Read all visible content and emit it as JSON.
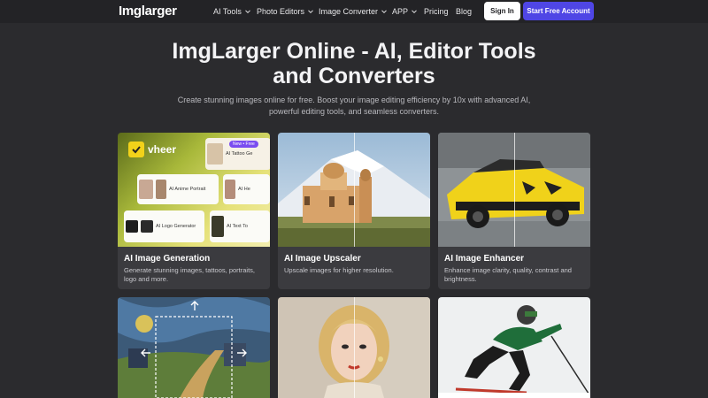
{
  "nav": {
    "logo": "Imglarger",
    "items": [
      "AI Tools",
      "Photo Editors",
      "Image Converter",
      "APP",
      "Pricing",
      "Blog"
    ],
    "signin": "Sign In",
    "start": "Start Free Account"
  },
  "hero": {
    "title_line1": "ImgLarger Online - AI, Editor Tools",
    "title_line2": "and Converters",
    "subtitle_line1": "Create stunning images online for free. Boost your image editing efficiency by 10x with advanced AI,",
    "subtitle_line2": "powerful editing tools, and seamless converters."
  },
  "cards": [
    {
      "title": "AI Image Generation",
      "desc": "Generate stunning images, tattoos, portraits, logo and more."
    },
    {
      "title": "AI Image Upscaler",
      "desc": "Upscale images for higher resolution."
    },
    {
      "title": "AI Image Enhancer",
      "desc": "Enhance image clarity, quality, contrast and brightness."
    }
  ],
  "vheer": {
    "brand": "vheer",
    "badge": "New • Free",
    "tiles": [
      "AI Tattoo Ge",
      "AI Anime Portrait",
      "AI He",
      "AI Logo Generator",
      "AI Text To"
    ]
  }
}
